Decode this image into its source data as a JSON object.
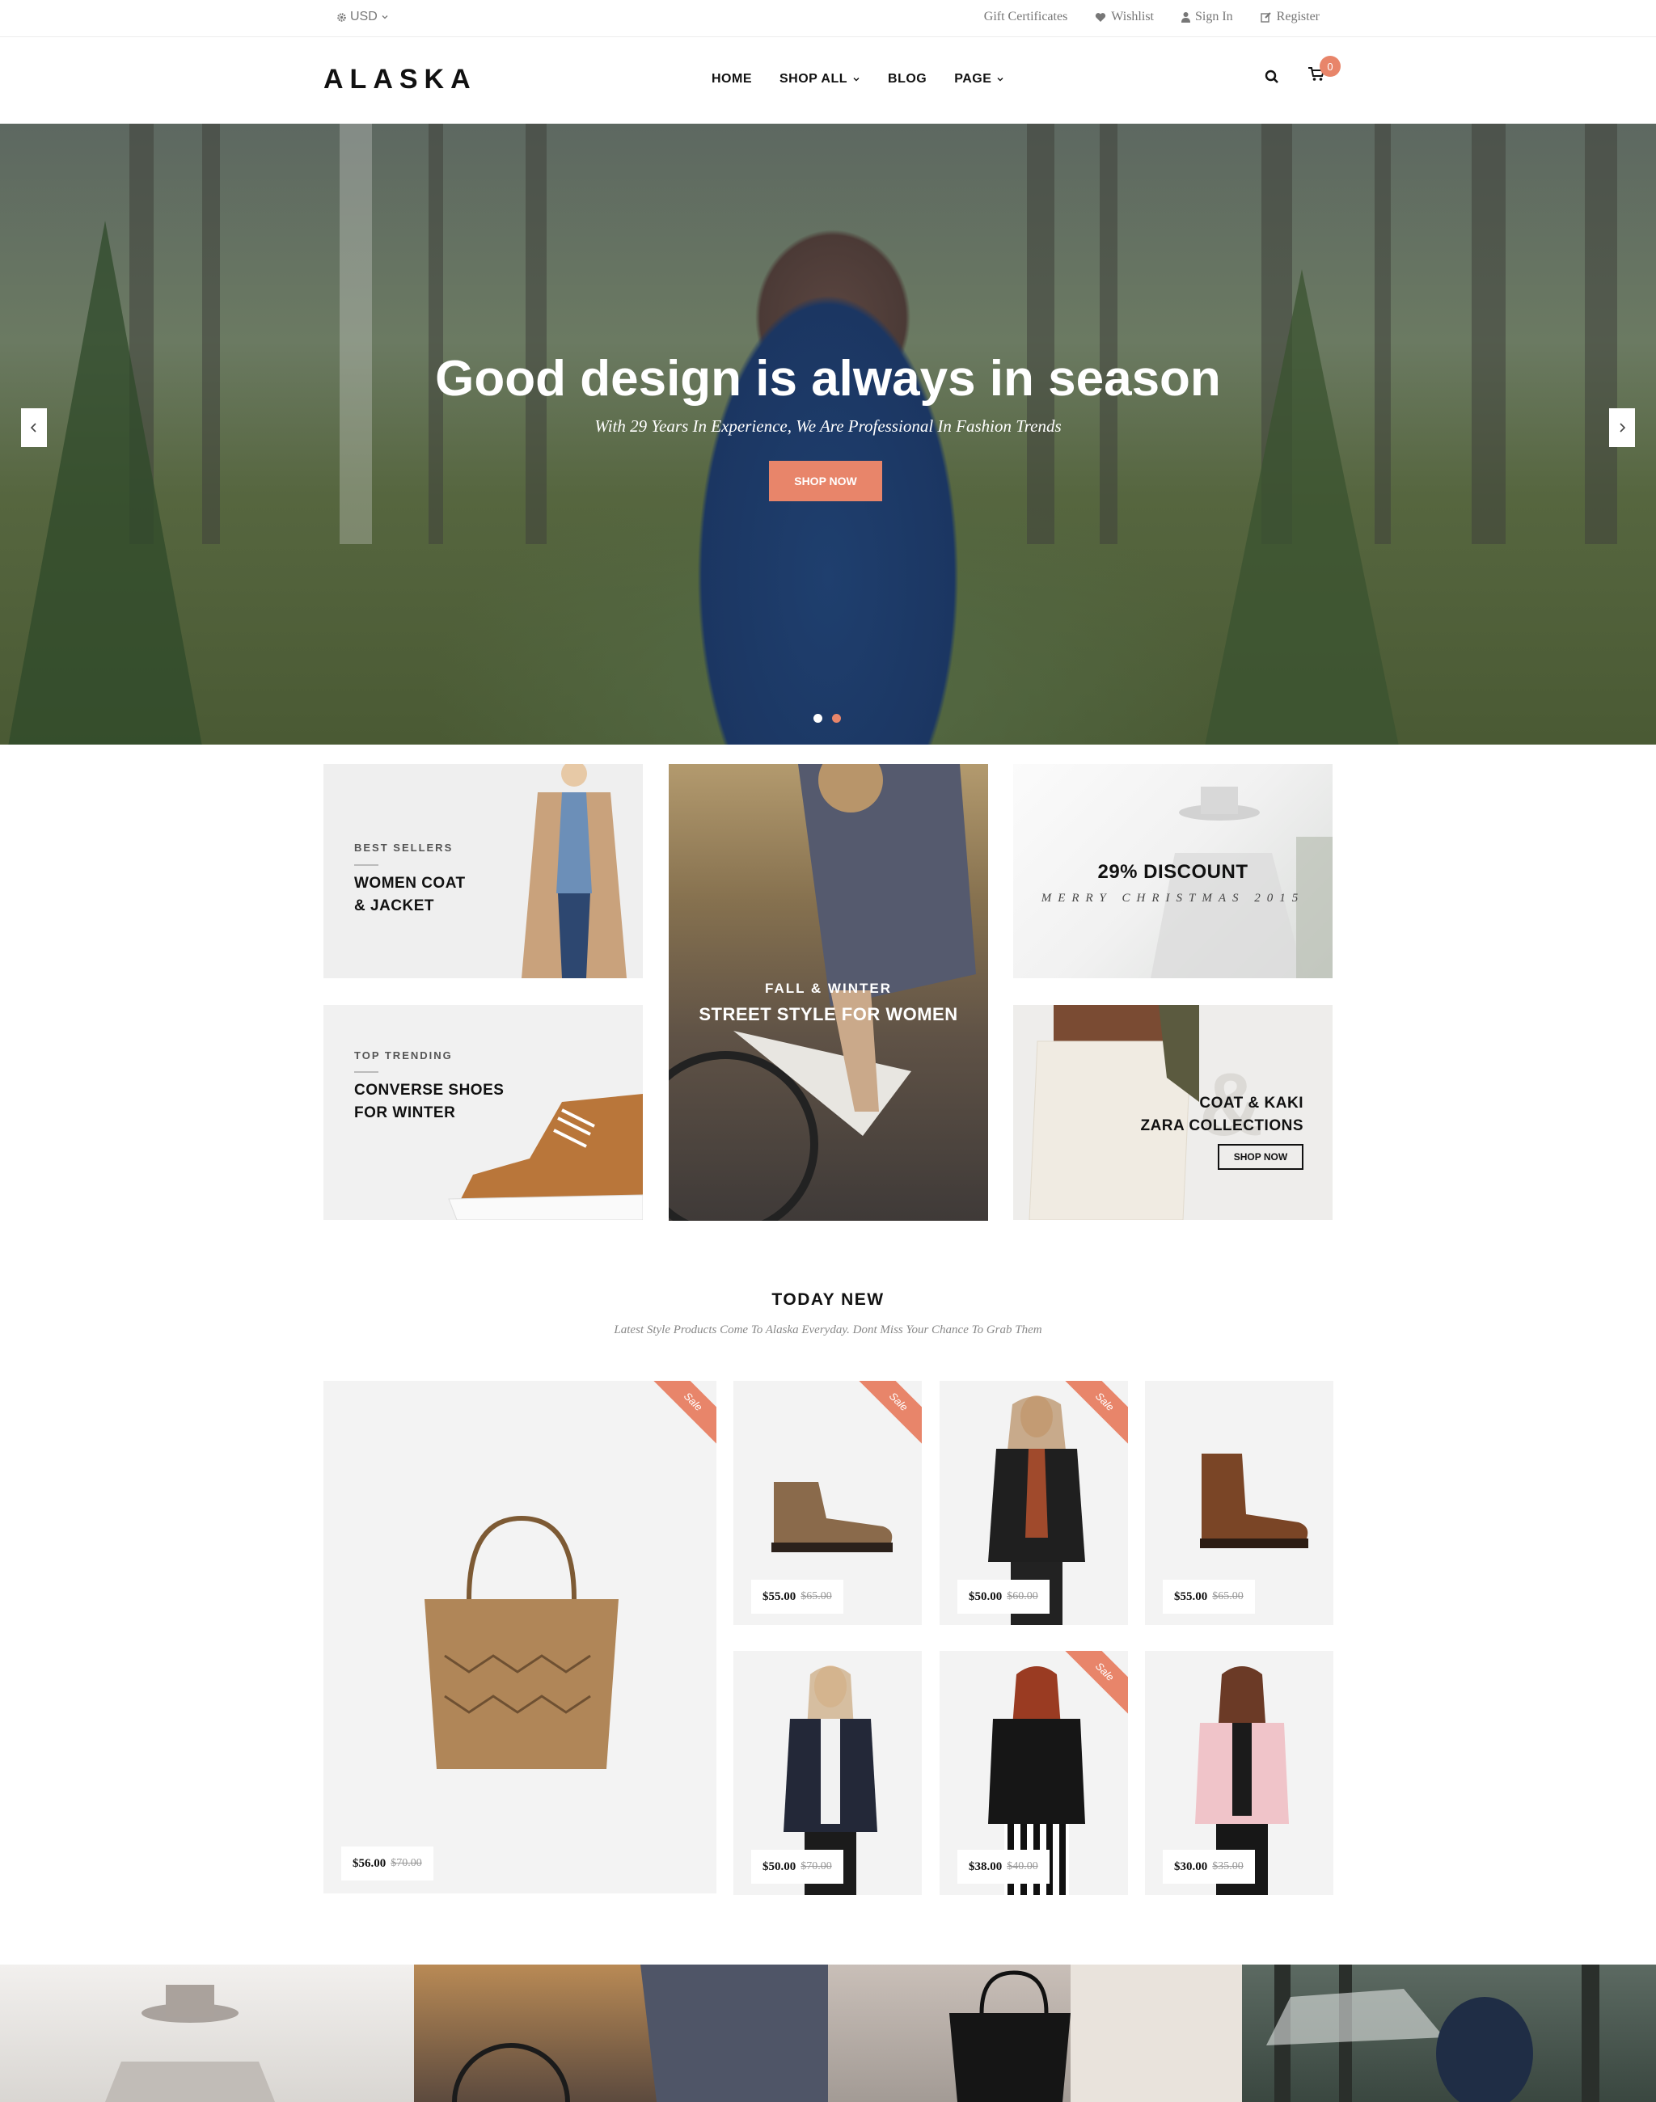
{
  "topbar": {
    "currency": "USD",
    "links": {
      "gift": "Gift Certificates",
      "wishlist": "Wishlist",
      "signin": "Sign In",
      "register": "Register"
    }
  },
  "header": {
    "logo": "ALASKA",
    "nav": {
      "home": "HOME",
      "shop_all": "SHOP ALL",
      "blog": "BLOG",
      "page": "PAGE"
    },
    "cart_count": "0"
  },
  "hero": {
    "title": "Good design is always in season",
    "subtitle": "With 29 Years In Experience, We Are Professional In Fashion Trends",
    "cta": "SHOP NOW",
    "slide_count": 2,
    "active_slide": 2
  },
  "banners": {
    "b1": {
      "eyebrow": "BEST SELLERS",
      "line1": "WOMEN COAT",
      "line2": "& JACKET"
    },
    "b2": {
      "eyebrow": "FALL & WINTER",
      "title": "STREET STYLE FOR WOMEN"
    },
    "b3": {
      "title": "29% DISCOUNT",
      "subtitle": "MERRY CHRISTMAS 2015"
    },
    "b4": {
      "eyebrow": "TOP TRENDING",
      "line1": "CONVERSE SHOES",
      "line2": "FOR WINTER"
    },
    "b5": {
      "line1": "COAT & KAKI",
      "line2": "ZARA COLLECTIONS",
      "cta": "SHOP NOW"
    }
  },
  "section": {
    "title": "TODAY NEW",
    "subtitle": "Latest Style Products Come To Alaska Everyday. Dont Miss Your Chance To Grab Them"
  },
  "sale_label": "Sale",
  "products": [
    {
      "name": "tote-bag",
      "price": "$56.00",
      "old": "$70.00",
      "sale": true
    },
    {
      "name": "leather-boot",
      "price": "$55.00",
      "old": "$65.00",
      "sale": true
    },
    {
      "name": "black-leather-jacket",
      "price": "$50.00",
      "old": "$60.00",
      "sale": true
    },
    {
      "name": "chelsea-boot",
      "price": "$55.00",
      "old": "$65.00",
      "sale": false
    },
    {
      "name": "navy-blazer",
      "price": "$50.00",
      "old": "$70.00",
      "sale": false
    },
    {
      "name": "biker-jacket",
      "price": "$38.00",
      "old": "$40.00",
      "sale": true
    },
    {
      "name": "pink-jacket",
      "price": "$30.00",
      "old": "$35.00",
      "sale": false
    }
  ],
  "colors": {
    "accent": "#e8856a",
    "text": "#111111",
    "muted": "#888888",
    "card_bg": "#f3f3f3"
  }
}
